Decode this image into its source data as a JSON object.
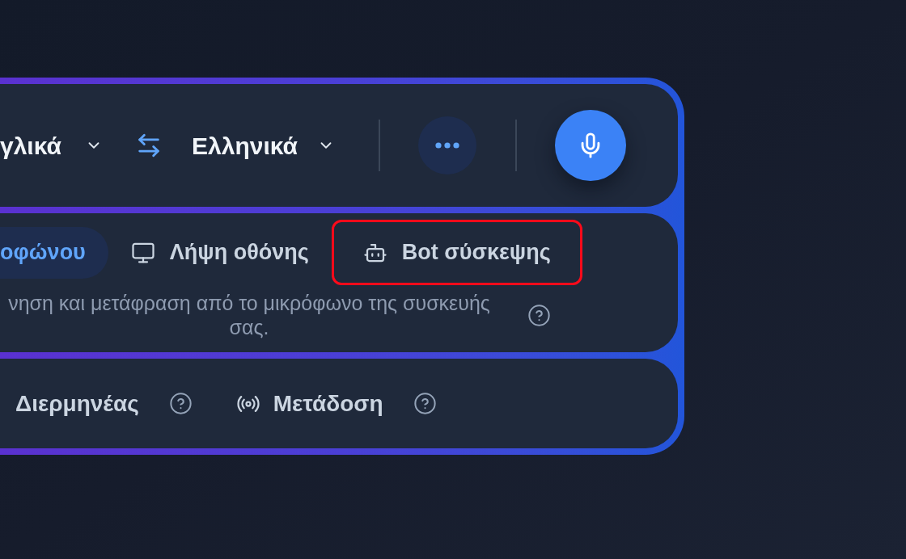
{
  "language_bar": {
    "source_language": "γλικά",
    "target_language": "Ελληνικά"
  },
  "input_modes": [
    {
      "label": "οφώνου",
      "kind": "plain",
      "selected": true,
      "highlighted": false
    },
    {
      "label": "Λήψη οθόνης",
      "kind": "screen",
      "selected": false,
      "highlighted": false
    },
    {
      "label": "Bot σύσκεψης",
      "kind": "bot",
      "selected": false,
      "highlighted": true
    }
  ],
  "mode_description": "νηση και μετάφραση από το μικρόφωνο της συσκευής σας.",
  "features": [
    {
      "label": "Διερμηνέας",
      "kind": "plain"
    },
    {
      "label": "Μετάδοση",
      "kind": "broadcast"
    }
  ]
}
